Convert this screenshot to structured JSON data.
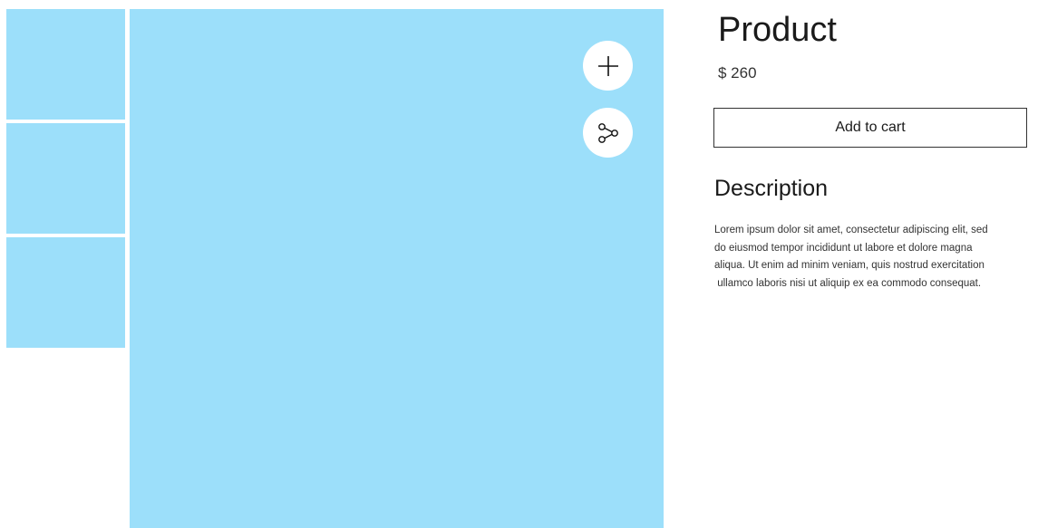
{
  "gallery": {
    "thumbnail_count": 3,
    "image_color": "#9cdffa",
    "buttons": [
      {
        "icon": "plus-icon",
        "action": "zoom"
      },
      {
        "icon": "share-icon",
        "action": "share"
      }
    ]
  },
  "product": {
    "title": "Product",
    "price": "$ 260",
    "add_to_cart_label": "Add to cart"
  },
  "description": {
    "heading": "Description",
    "lines": [
      "Lorem ipsum dolor sit amet, consectetur adipiscing elit, sed",
      "do eiusmod tempor incididunt ut labore et dolore magna",
      "aliqua. Ut enim ad minim veniam, quis nostrud exercitation",
      " ullamco laboris nisi ut aliquip ex ea commodo consequat."
    ]
  }
}
